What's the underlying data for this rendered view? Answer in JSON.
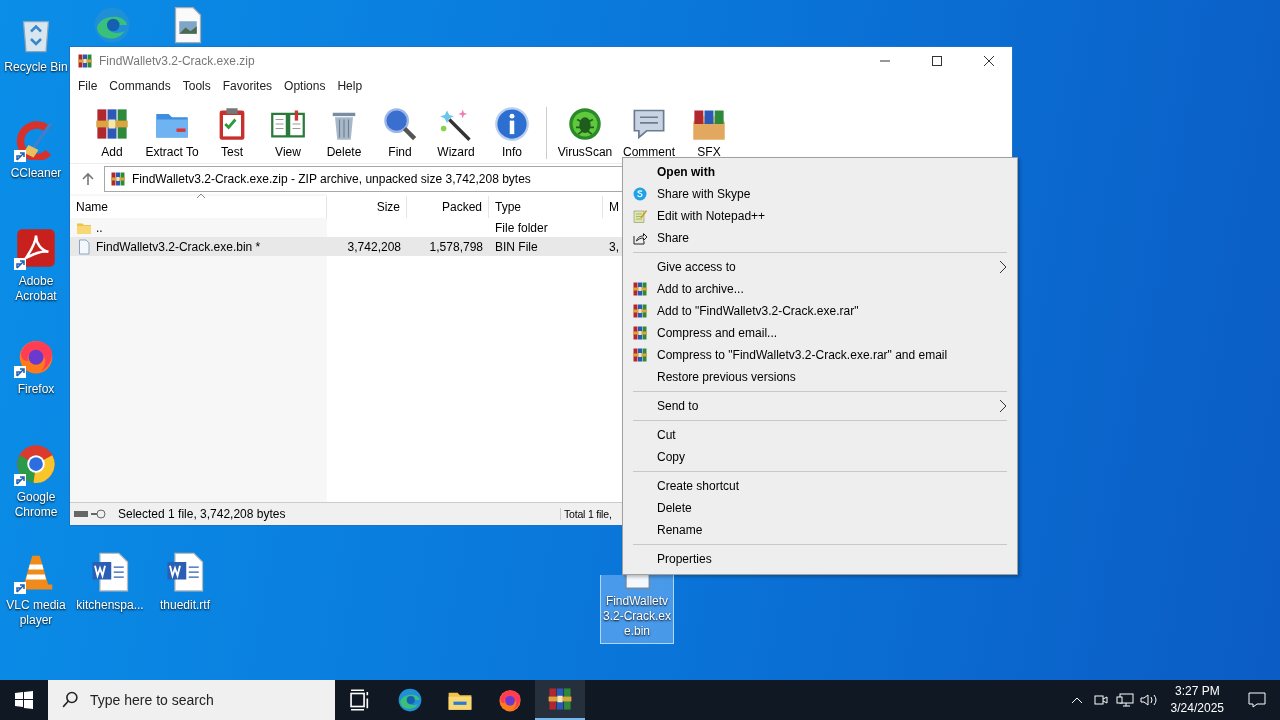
{
  "desktop": {
    "icons": [
      {
        "kind": "recycle",
        "label": "Recycle Bin",
        "shortcut": false,
        "selected": false
      },
      {
        "kind": "edge",
        "shortcut": false,
        "selected": false
      },
      {
        "kind": "image-file",
        "shortcut": false,
        "selected": false
      },
      {
        "kind": "ccleaner",
        "label": "CCleaner",
        "shortcut": true,
        "selected": false
      },
      {
        "kind": "acrobat",
        "label": "Adobe Acrobat",
        "shortcut": true,
        "selected": false
      },
      {
        "kind": "firefox",
        "label": "Firefox",
        "shortcut": true,
        "selected": false
      },
      {
        "kind": "chrome",
        "label": "Google Chrome",
        "shortcut": true,
        "selected": false
      },
      {
        "kind": "vlc",
        "label": "VLC media player",
        "shortcut": true,
        "selected": false
      },
      {
        "kind": "word",
        "label": "kitchenspa...",
        "shortcut": false,
        "selected": false
      },
      {
        "kind": "word",
        "label": "thuedit.rtf",
        "shortcut": false,
        "selected": false
      },
      {
        "kind": "file",
        "label": "FindWalletv3.2-Crack.exe.bin",
        "shortcut": false,
        "selected": true
      }
    ]
  },
  "window": {
    "title": "FindWalletv3.2-Crack.exe.zip",
    "menu": [
      "File",
      "Commands",
      "Tools",
      "Favorites",
      "Options",
      "Help"
    ],
    "toolbar": [
      [
        {
          "kind": "add",
          "label": "Add"
        },
        {
          "kind": "extract",
          "label": "Extract To"
        },
        {
          "kind": "test",
          "label": "Test"
        },
        {
          "kind": "view",
          "label": "View"
        },
        {
          "kind": "delete",
          "label": "Delete"
        },
        {
          "kind": "find",
          "label": "Find"
        },
        {
          "kind": "wizard",
          "label": "Wizard"
        },
        {
          "kind": "info",
          "label": "Info"
        }
      ],
      [
        {
          "kind": "virusscan",
          "label": "VirusScan"
        },
        {
          "kind": "comment",
          "label": "Comment"
        },
        {
          "kind": "sfx",
          "label": "SFX"
        }
      ]
    ],
    "address": "FindWalletv3.2-Crack.exe.zip - ZIP archive, unpacked size 3,742,208 bytes",
    "columns": [
      "Name",
      "Size",
      "Packed",
      "Type",
      "M"
    ],
    "rows": [
      {
        "kind": "folder",
        "name": "..",
        "type": "File folder",
        "selected": false
      },
      {
        "kind": "file",
        "name": "FindWalletv3.2-Crack.exe.bin *",
        "size": "3,742,208",
        "packed": "1,578,798",
        "type": "BIN File",
        "column_5": "3,",
        "selected": true
      }
    ],
    "status_bar": {
      "left": "Selected 1 file, 3,742,208 bytes",
      "right": "Total 1 file,"
    }
  },
  "context_menu": {
    "sections": [
      [
        {
          "label": "Open with",
          "default": true,
          "submenu": false
        },
        {
          "label": "Share with Skype",
          "kind": "skype",
          "default": false,
          "submenu": false
        },
        {
          "label": "Edit with Notepad++",
          "kind": "notepad",
          "default": false,
          "submenu": false
        },
        {
          "label": "Share",
          "kind": "share",
          "default": false,
          "submenu": false
        }
      ],
      [
        {
          "label": "Give access to",
          "default": false,
          "submenu": true
        },
        {
          "label": "Add to archive...",
          "kind": "winrar",
          "default": false,
          "submenu": false
        },
        {
          "label": "Add to \"FindWalletv3.2-Crack.exe.rar\"",
          "kind": "winrar",
          "default": false,
          "submenu": false
        },
        {
          "label": "Compress and email...",
          "kind": "winrar",
          "default": false,
          "submenu": false
        },
        {
          "label": "Compress to \"FindWalletv3.2-Crack.exe.rar\" and email",
          "kind": "winrar",
          "default": false,
          "submenu": false
        },
        {
          "label": "Restore previous versions",
          "default": false,
          "submenu": false
        }
      ],
      [
        {
          "label": "Send to",
          "default": false,
          "submenu": true
        }
      ],
      [
        {
          "label": "Cut",
          "default": false,
          "submenu": false
        },
        {
          "label": "Copy",
          "default": false,
          "submenu": false
        }
      ],
      [
        {
          "label": "Create shortcut",
          "default": false,
          "submenu": false
        },
        {
          "label": "Delete",
          "default": false,
          "submenu": false
        },
        {
          "label": "Rename",
          "default": false,
          "submenu": false
        }
      ],
      [
        {
          "label": "Properties",
          "default": false,
          "submenu": false
        }
      ]
    ]
  },
  "taskbar": {
    "search": {
      "placeholder": "Type here to search"
    },
    "apps": [
      {
        "kind": "task-view",
        "active": false
      },
      {
        "kind": "edge",
        "active": false
      },
      {
        "kind": "explorer",
        "active": false
      },
      {
        "kind": "firefox",
        "active": false
      },
      {
        "kind": "winrar",
        "active": true
      }
    ],
    "time": "3:27 PM",
    "date": "3/24/2025"
  }
}
